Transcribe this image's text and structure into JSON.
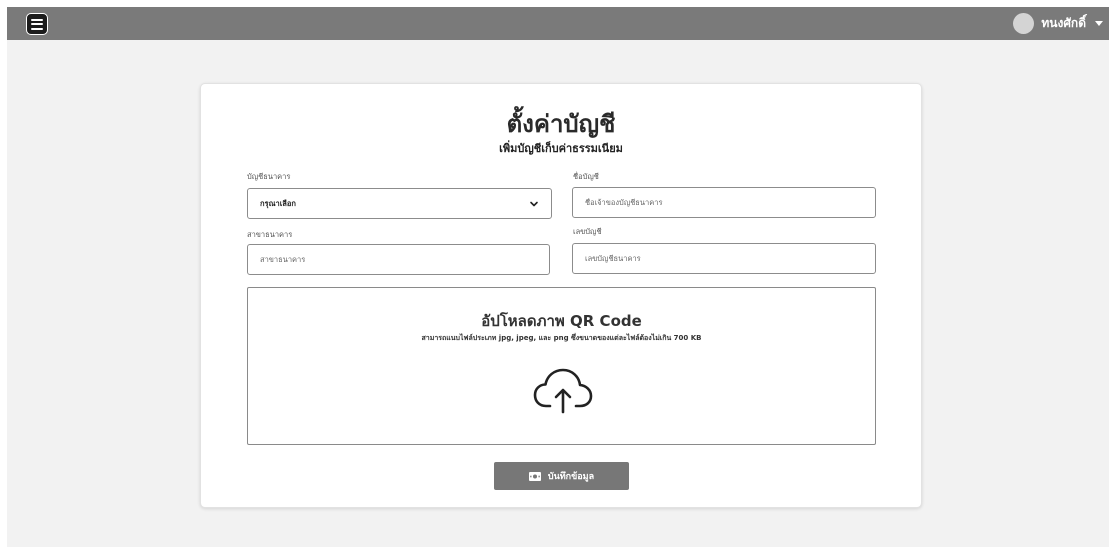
{
  "topbar": {
    "user_name": "ทนงศักดิ์"
  },
  "page": {
    "title": "ตั้งค่าบัญชี",
    "subtitle": "เพิ่มบัญชีเก็บค่าธรรมเนียม"
  },
  "form": {
    "bank_account_label": "บัญชีธนาคาร",
    "bank_select_value": "กรุณาเลือก",
    "account_name_label": "ชื่อบัญชี",
    "account_name_placeholder": "ชื่อเจ้าของบัญชีธนาคาร",
    "branch_label": "สาขาธนาคาร",
    "branch_placeholder": "สาขาธนาคาร",
    "account_number_label": "เลขบัญชี",
    "account_number_placeholder": "เลขบัญชีธนาคาร"
  },
  "upload": {
    "title": "อัปโหลดภาพ QR Code",
    "description": "สามารถแนบไฟล์ประเภท jpg, jpeg, และ png ซึ่งขนาดของแต่ละไฟล์ต้องไม่เกิน 700 KB"
  },
  "actions": {
    "save_label": "บันทึกข้อมูล"
  },
  "icons": {
    "menu": "hamburger-menu-icon",
    "upload": "cloud-upload-icon",
    "save": "money-icon",
    "select": "chevron-down-icon",
    "user_menu": "caret-down-icon"
  }
}
